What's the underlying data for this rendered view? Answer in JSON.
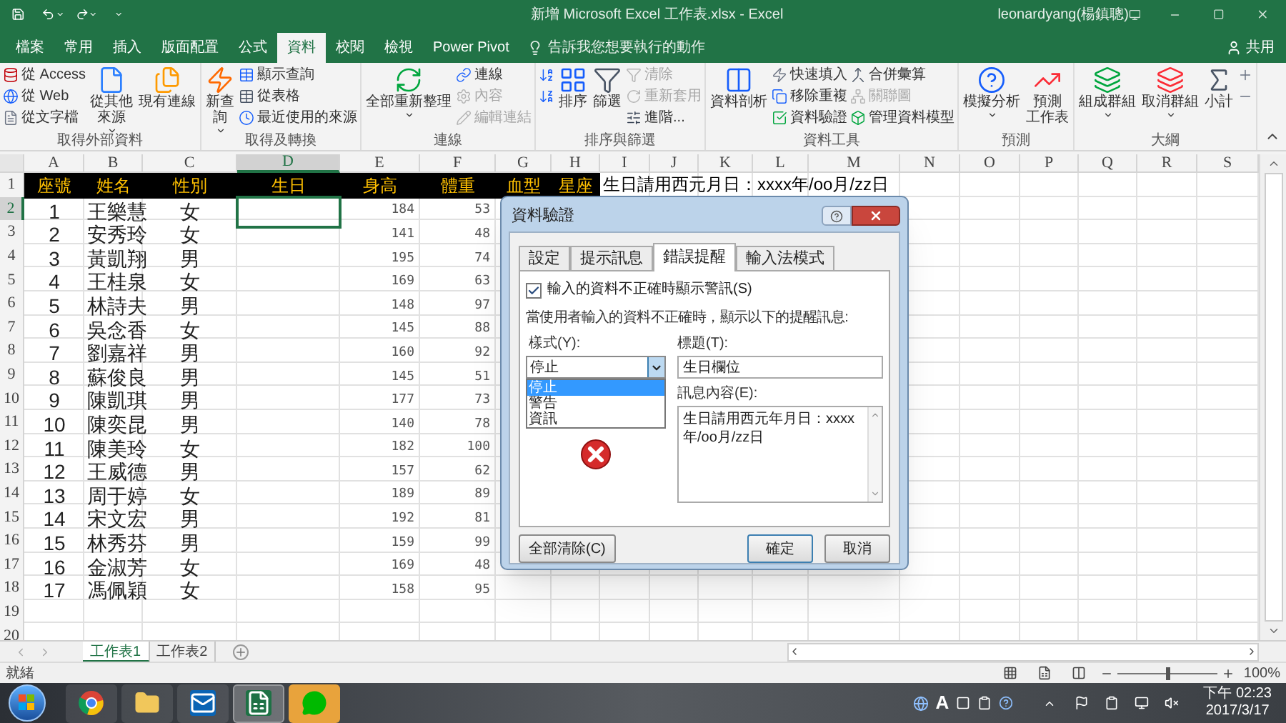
{
  "title_bar": {
    "title": "新增 Microsoft Excel 工作表.xlsx - Excel",
    "user": "leonardyang(楊鎮聰)"
  },
  "ribbon_tabs": [
    {
      "label": "檔案",
      "selected": false
    },
    {
      "label": "常用",
      "selected": false
    },
    {
      "label": "插入",
      "selected": false
    },
    {
      "label": "版面配置",
      "selected": false
    },
    {
      "label": "公式",
      "selected": false
    },
    {
      "label": "資料",
      "selected": true
    },
    {
      "label": "校閱",
      "selected": false
    },
    {
      "label": "檢視",
      "selected": false
    },
    {
      "label": "Power Pivot",
      "selected": false
    }
  ],
  "tell_me": {
    "placeholder": "告訴我您想要執行的動作"
  },
  "share": "共用",
  "ribbon_groups": [
    {
      "label": "取得外部資料",
      "items": [
        {
          "kind": "stack",
          "buttons": [
            {
              "label": "從 Access",
              "disabled": false
            },
            {
              "label": "從 Web",
              "disabled": false
            },
            {
              "label": "從文字檔",
              "disabled": false
            }
          ]
        },
        {
          "kind": "large",
          "lines": [
            "從其他",
            "來源"
          ],
          "menu": true
        },
        {
          "kind": "large",
          "lines": [
            "現有連線"
          ],
          "menu": false
        }
      ]
    },
    {
      "label": "取得及轉換",
      "items": [
        {
          "kind": "large",
          "lines": [
            "新查",
            "詢"
          ],
          "menu": true
        },
        {
          "kind": "stack",
          "buttons": [
            {
              "label": "顯示查詢",
              "disabled": false
            },
            {
              "label": "從表格",
              "disabled": false
            },
            {
              "label": "最近使用的來源",
              "disabled": false
            }
          ]
        }
      ]
    },
    {
      "label": "連線",
      "items": [
        {
          "kind": "large",
          "lines": [
            "全部重新整理"
          ],
          "menu": true
        },
        {
          "kind": "stack",
          "buttons": [
            {
              "label": "連線",
              "disabled": false
            },
            {
              "label": "內容",
              "disabled": true
            },
            {
              "label": "編輯連結",
              "disabled": true
            }
          ]
        }
      ]
    },
    {
      "label": "排序與篩選",
      "items": [
        {
          "kind": "stack",
          "buttons": [
            {
              "disabled": false
            },
            {
              "disabled": false
            }
          ]
        },
        {
          "kind": "large",
          "lines": [
            "排序"
          ],
          "menu": false
        },
        {
          "kind": "large",
          "lines": [
            "篩選"
          ],
          "menu": false
        },
        {
          "kind": "stack",
          "buttons": [
            {
              "label": "清除",
              "disabled": true
            },
            {
              "label": "重新套用",
              "disabled": true
            },
            {
              "label": "進階...",
              "disabled": false
            }
          ]
        }
      ]
    },
    {
      "label": "資料工具",
      "items": [
        {
          "kind": "large",
          "lines": [
            "資料剖析"
          ],
          "menu": false
        },
        {
          "kind": "stack",
          "buttons": [
            {
              "label": "快速填入",
              "disabled": false
            },
            {
              "label": "移除重複",
              "disabled": false
            },
            {
              "label": "資料驗證",
              "disabled": false
            }
          ]
        },
        {
          "kind": "stack",
          "buttons": [
            {
              "label": "合併彙算",
              "disabled": false
            },
            {
              "label": "關聯圖",
              "disabled": true
            },
            {
              "label": "管理資料模型",
              "disabled": false
            }
          ]
        }
      ]
    },
    {
      "label": "預測",
      "items": [
        {
          "kind": "large",
          "lines": [
            "模擬分析"
          ],
          "menu": true
        },
        {
          "kind": "large",
          "lines": [
            "預測",
            "工作表"
          ],
          "menu": false
        }
      ]
    },
    {
      "label": "大綱",
      "items": [
        {
          "kind": "large",
          "lines": [
            "組成群組"
          ],
          "menu": true
        },
        {
          "kind": "large",
          "lines": [
            "取消群組"
          ],
          "menu": true
        },
        {
          "kind": "large",
          "lines": [
            "小計"
          ],
          "menu": false
        },
        {
          "kind": "stack",
          "buttons": [
            {
              "disabled": false
            },
            {
              "disabled": false
            }
          ]
        }
      ]
    }
  ],
  "sheet": {
    "columns": [
      {
        "label": "A",
        "selected": false
      },
      {
        "label": "B",
        "selected": false
      },
      {
        "label": "C",
        "selected": false
      },
      {
        "label": "D",
        "selected": true
      },
      {
        "label": "E",
        "selected": false
      },
      {
        "label": "F",
        "selected": false
      },
      {
        "label": "G",
        "selected": false
      },
      {
        "label": "H",
        "selected": false
      },
      {
        "label": "I",
        "selected": false
      },
      {
        "label": "J",
        "selected": false
      },
      {
        "label": "K",
        "selected": false
      },
      {
        "label": "L",
        "selected": false
      },
      {
        "label": "M",
        "selected": false
      },
      {
        "label": "N",
        "selected": false
      },
      {
        "label": "O",
        "selected": false
      },
      {
        "label": "P",
        "selected": false
      },
      {
        "label": "Q",
        "selected": false
      },
      {
        "label": "R",
        "selected": false
      },
      {
        "label": "S",
        "selected": false
      }
    ],
    "rows": [
      {
        "number": "1",
        "selected": false,
        "kind": "header",
        "cells": [
          "座號",
          "姓名",
          "性別",
          "生日",
          "身高",
          "體重",
          "血型",
          "星座"
        ],
        "note": "生日請用西元月日：xxxx年/oo月/zz日"
      },
      {
        "number": "2",
        "selected": true,
        "cells": [
          "1",
          "王樂慧",
          "女",
          null,
          "184",
          "53"
        ]
      },
      {
        "number": "3",
        "selected": false,
        "cells": [
          "2",
          "安秀玲",
          "女",
          null,
          "141",
          "48"
        ]
      },
      {
        "number": "4",
        "selected": false,
        "cells": [
          "3",
          "黃凱翔",
          "男",
          null,
          "195",
          "74"
        ]
      },
      {
        "number": "5",
        "selected": false,
        "cells": [
          "4",
          "王桂泉",
          "女",
          null,
          "169",
          "63"
        ]
      },
      {
        "number": "6",
        "selected": false,
        "cells": [
          "5",
          "林詩夫",
          "男",
          null,
          "148",
          "97"
        ]
      },
      {
        "number": "7",
        "selected": false,
        "cells": [
          "6",
          "吳念香",
          "女",
          null,
          "145",
          "88"
        ]
      },
      {
        "number": "8",
        "selected": false,
        "cells": [
          "7",
          "劉嘉祥",
          "男",
          null,
          "160",
          "92"
        ]
      },
      {
        "number": "9",
        "selected": false,
        "cells": [
          "8",
          "蘇俊良",
          "男",
          null,
          "145",
          "51"
        ]
      },
      {
        "number": "10",
        "selected": false,
        "cells": [
          "9",
          "陳凱琪",
          "男",
          null,
          "177",
          "73"
        ]
      },
      {
        "number": "11",
        "selected": false,
        "cells": [
          "10",
          "陳奕昆",
          "男",
          null,
          "140",
          "78"
        ]
      },
      {
        "number": "12",
        "selected": false,
        "cells": [
          "11",
          "陳美玲",
          "女",
          null,
          "182",
          "100"
        ]
      },
      {
        "number": "13",
        "selected": false,
        "cells": [
          "12",
          "王威德",
          "男",
          null,
          "157",
          "62"
        ]
      },
      {
        "number": "14",
        "selected": false,
        "cells": [
          "13",
          "周于婷",
          "女",
          null,
          "189",
          "89"
        ]
      },
      {
        "number": "15",
        "selected": false,
        "cells": [
          "14",
          "宋文宏",
          "男",
          null,
          "192",
          "81"
        ]
      },
      {
        "number": "16",
        "selected": false,
        "cells": [
          "15",
          "林秀芬",
          "男",
          null,
          "159",
          "99"
        ]
      },
      {
        "number": "17",
        "selected": false,
        "cells": [
          "16",
          "金淑芳",
          "女",
          null,
          "169",
          "48"
        ]
      },
      {
        "number": "18",
        "selected": false,
        "cells": [
          "17",
          "馮佩穎",
          "女",
          null,
          "158",
          "95"
        ]
      },
      {
        "number": "19",
        "selected": false
      },
      {
        "number": "20",
        "selected": false
      }
    ]
  },
  "dialog": {
    "title": "資料驗證",
    "tabs": [
      {
        "label": "設定",
        "selected": false
      },
      {
        "label": "提示訊息",
        "selected": false
      },
      {
        "label": "錯誤提醒",
        "selected": true
      },
      {
        "label": "輸入法模式",
        "selected": false
      }
    ],
    "show_alert": {
      "label": "輸入的資料不正確時顯示警訊(S)",
      "checked": true
    },
    "instruction": "當使用者輸入的資料不正確時，顯示以下的提醒訊息:",
    "style": {
      "label": "樣式(Y):",
      "value": "停止",
      "options": [
        {
          "label": "停止",
          "selected": true
        },
        {
          "label": "警告",
          "selected": false
        },
        {
          "label": "資訊",
          "selected": false
        }
      ]
    },
    "alert_title": {
      "label": "標題(T):",
      "value": "生日欄位"
    },
    "message": {
      "label": "訊息內容(E):",
      "value": "生日請用西元年月日：xxxx年/oo月/zz日"
    },
    "buttons": [
      {
        "label": "全部清除(C)",
        "kind": "clear"
      },
      {
        "label": "確定",
        "kind": "ok"
      },
      {
        "label": "取消",
        "kind": "cancel"
      }
    ]
  },
  "sheet_tabs": [
    {
      "label": "工作表1",
      "selected": true
    },
    {
      "label": "工作表2",
      "selected": false
    }
  ],
  "status_bar": {
    "status": "就緒",
    "zoom": "100%",
    "zoom_level": {
      "level": 0.5
    }
  },
  "taskbar": {
    "ime": "A",
    "time": "下午 02:23",
    "date": "2017/3/17"
  }
}
